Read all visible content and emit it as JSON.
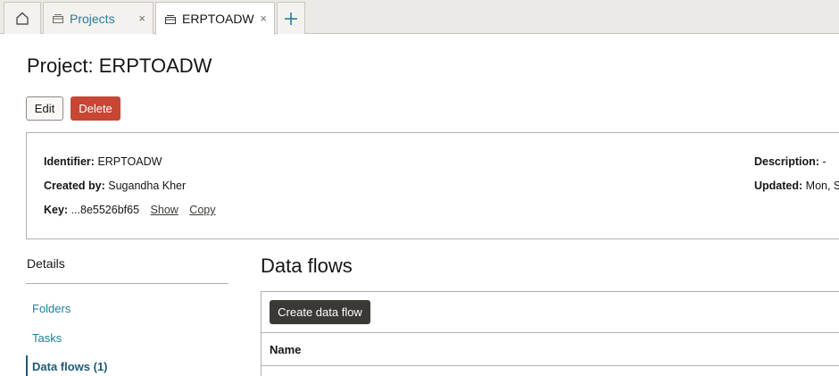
{
  "tabs": {
    "projects_label": "Projects",
    "active_label": "ERPTOADW",
    "close_glyph": "×",
    "add_glyph": "+"
  },
  "page": {
    "title": "Project: ERPTOADW",
    "edit_label": "Edit",
    "delete_label": "Delete"
  },
  "info": {
    "identifier_label": "Identifier:",
    "identifier_value": "ERPTOADW",
    "created_by_label": "Created by:",
    "created_by_value": "Sugandha Kher",
    "key_label": "Key:",
    "key_value": "...8e5526bf65",
    "show_link": "Show",
    "copy_link": "Copy",
    "description_label": "Description:",
    "description_value": "-",
    "updated_label": "Updated:",
    "updated_value": "Mon, S"
  },
  "nav": {
    "title": "Details",
    "items": [
      {
        "label": "Folders"
      },
      {
        "label": "Tasks"
      },
      {
        "label": "Data flows (1)"
      }
    ]
  },
  "data_flows": {
    "title": "Data flows",
    "create_label": "Create data flow",
    "columns": [
      "Name"
    ]
  },
  "colors": {
    "accent_link": "#227e9e",
    "delete_red": "#c74634",
    "primary_dark": "#3a3935"
  }
}
